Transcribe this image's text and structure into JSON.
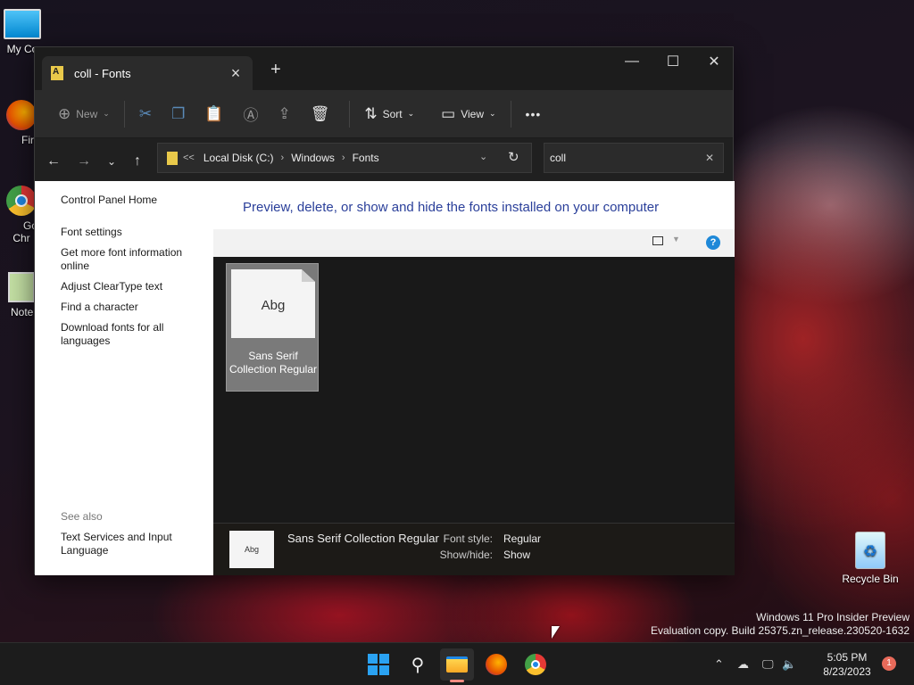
{
  "desktop": {
    "icons": [
      {
        "label": "My Co",
        "icon": "monitor-icon"
      },
      {
        "label": "Fire",
        "icon": "firefox-icon"
      },
      {
        "label": "Goo\nChr",
        "icon": "chrome-icon"
      },
      {
        "label": "Notep",
        "icon": "notepad-icon"
      },
      {
        "label": "Recycle Bin",
        "icon": "recycle-bin-icon"
      }
    ],
    "watermark": {
      "line1": "Windows 11 Pro Insider Preview",
      "line2": "Evaluation copy. Build 25375.zn_release.230520-1632"
    }
  },
  "window": {
    "tab_title": "coll - Fonts",
    "new_tab": "+",
    "controls": {
      "minimize": "—",
      "maximize": "☐",
      "close": "✕"
    },
    "toolbar": {
      "new_label": "New",
      "sort_label": "Sort",
      "view_label": "View",
      "more": "•••"
    },
    "address": {
      "overflow": "<<",
      "crumbs": [
        "Local Disk (C:)",
        "Windows",
        "Fonts"
      ]
    },
    "search": {
      "value": "coll",
      "clear": "✕"
    }
  },
  "sidebar": {
    "home": "Control Panel Home",
    "links": [
      "Font settings",
      "Get more font information online",
      "Adjust ClearType text",
      "Find a character",
      "Download fonts for all languages"
    ],
    "see_also": "See also",
    "see_also_links": [
      "Text Services and Input Language"
    ]
  },
  "content": {
    "heading": "Preview, delete, or show and hide the fonts installed on your computer",
    "help": "?",
    "items": [
      {
        "sample": "Abg",
        "name": "Sans Serif Collection Regular"
      }
    ]
  },
  "details": {
    "thumb": "Abg",
    "font_name": "Sans Serif Collection Regular",
    "style_label": "Font style:",
    "style_value": "Regular",
    "show_label": "Show/hide:",
    "show_value": "Show"
  },
  "taskbar": {
    "time": "5:05 PM",
    "date": "8/23/2023",
    "notification_count": "1"
  }
}
